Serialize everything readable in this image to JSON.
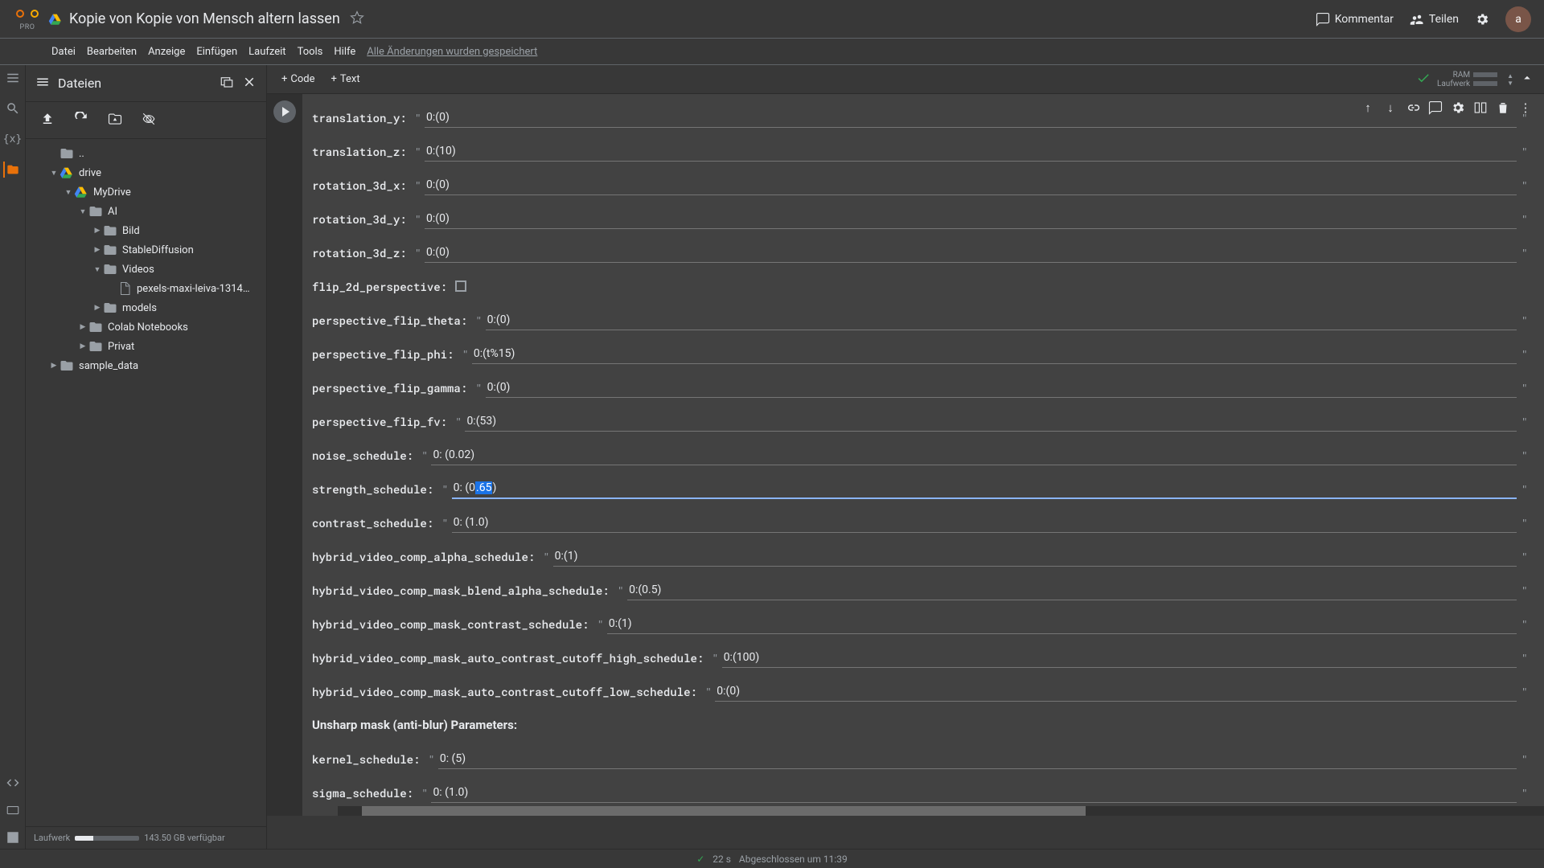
{
  "header": {
    "pro_label": "PRO",
    "title": "Kopie von Kopie von Mensch altern lassen",
    "comment": "Kommentar",
    "share": "Teilen",
    "avatar_letter": "a"
  },
  "menubar": {
    "items": [
      "Datei",
      "Bearbeiten",
      "Anzeige",
      "Einfügen",
      "Laufzeit",
      "Tools",
      "Hilfe"
    ],
    "saved": "Alle Änderungen wurden gespeichert"
  },
  "sidebar": {
    "title": "Dateien",
    "tree": [
      {
        "depth": 0,
        "arrow": "",
        "icon": "folder",
        "label": ".."
      },
      {
        "depth": 0,
        "arrow": "▼",
        "icon": "drive",
        "label": "drive"
      },
      {
        "depth": 1,
        "arrow": "▼",
        "icon": "drive",
        "label": "MyDrive"
      },
      {
        "depth": 2,
        "arrow": "▼",
        "icon": "folder",
        "label": "AI"
      },
      {
        "depth": 3,
        "arrow": "▶",
        "icon": "folder",
        "label": "Bild"
      },
      {
        "depth": 3,
        "arrow": "▶",
        "icon": "folder",
        "label": "StableDiffusion"
      },
      {
        "depth": 3,
        "arrow": "▼",
        "icon": "folder",
        "label": "Videos"
      },
      {
        "depth": 4,
        "arrow": "",
        "icon": "file",
        "label": "pexels-maxi-leiva-1314…"
      },
      {
        "depth": 3,
        "arrow": "▶",
        "icon": "folder",
        "label": "models"
      },
      {
        "depth": 2,
        "arrow": "▶",
        "icon": "folder",
        "label": "Colab Notebooks"
      },
      {
        "depth": 2,
        "arrow": "▶",
        "icon": "folder",
        "label": "Privat"
      },
      {
        "depth": 0,
        "arrow": "▶",
        "icon": "folder",
        "label": "sample_data"
      }
    ],
    "disk_label": "Laufwerk",
    "disk_free": "143.50 GB verfügbar"
  },
  "toolbar": {
    "code": "Code",
    "text": "Text",
    "ram": "RAM",
    "runtime": "Laufwerk"
  },
  "form": {
    "rows": [
      {
        "label": "translation_y:",
        "value": "0:(0)",
        "type": "text"
      },
      {
        "label": "translation_z:",
        "value": "0:(10)",
        "type": "text"
      },
      {
        "label": "rotation_3d_x:",
        "value": "0:(0)",
        "type": "text"
      },
      {
        "label": "rotation_3d_y:",
        "value": "0:(0)",
        "type": "text"
      },
      {
        "label": "rotation_3d_z:",
        "value": "0:(0)",
        "type": "text"
      },
      {
        "label": "flip_2d_perspective:",
        "value": "",
        "type": "check"
      },
      {
        "label": "perspective_flip_theta:",
        "value": "0:(0)",
        "type": "text"
      },
      {
        "label": "perspective_flip_phi:",
        "value": "0:(t%15)",
        "type": "text"
      },
      {
        "label": "perspective_flip_gamma:",
        "value": "0:(0)",
        "type": "text"
      },
      {
        "label": "perspective_flip_fv:",
        "value": "0:(53)",
        "type": "text"
      },
      {
        "label": "noise_schedule:",
        "value": "0: (0.02)",
        "type": "text"
      },
      {
        "label": "strength_schedule:",
        "value": "0: (0.65)",
        "type": "text",
        "focused": true,
        "sel": ".65"
      },
      {
        "label": "contrast_schedule:",
        "value": "0: (1.0)",
        "type": "text"
      },
      {
        "label": "hybrid_video_comp_alpha_schedule:",
        "value": "0:(1)",
        "type": "text"
      },
      {
        "label": "hybrid_video_comp_mask_blend_alpha_schedule:",
        "value": "0:(0.5)",
        "type": "text"
      },
      {
        "label": "hybrid_video_comp_mask_contrast_schedule:",
        "value": "0:(1)",
        "type": "text"
      },
      {
        "label": "hybrid_video_comp_mask_auto_contrast_cutoff_high_schedule:",
        "value": "0:(100)",
        "type": "text"
      },
      {
        "label": "hybrid_video_comp_mask_auto_contrast_cutoff_low_schedule:",
        "value": "0:(0)",
        "type": "text"
      }
    ],
    "section": "Unsharp mask (anti-blur) Parameters:",
    "rows2": [
      {
        "label": "kernel_schedule:",
        "value": "0: (5)",
        "type": "text"
      },
      {
        "label": "sigma_schedule:",
        "value": "0: (1.0)",
        "type": "text"
      }
    ]
  },
  "footer": {
    "time": "22 s",
    "status": "Abgeschlossen um 11:39"
  }
}
